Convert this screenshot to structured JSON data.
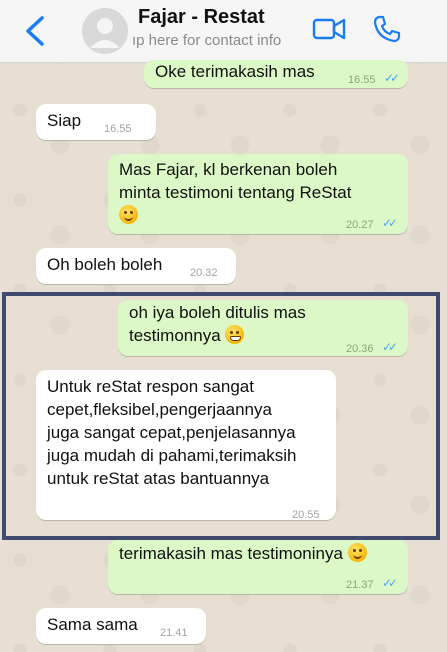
{
  "header": {
    "contact_name": "Fajar - Restat",
    "subtitle": "ıp here for contact info"
  },
  "messages": [
    {
      "dir": "out",
      "text": "Oke terimakasih mas",
      "time": "16.55"
    },
    {
      "dir": "in",
      "text": "Siap",
      "time": "16.55"
    },
    {
      "dir": "out",
      "lines": [
        "Mas Fajar, kl berkenan boleh",
        "minta testimoni tentang ReStat"
      ],
      "emoji": "smile",
      "time": "20.27"
    },
    {
      "dir": "in",
      "text": "Oh boleh boleh",
      "time": "20.32"
    },
    {
      "dir": "out",
      "lines": [
        "oh iya boleh ditulis mas",
        "testimonnya"
      ],
      "emoji": "grin",
      "time": "20.36"
    },
    {
      "dir": "in",
      "lines": [
        "Untuk reStat respon sangat",
        "cepet,fleksibel,pengerjaannya",
        "juga sangat cepat,penjelasannya",
        "juga mudah di pahami,terimaksih",
        "untuk reStat atas bantuannya"
      ],
      "time": "20.55"
    },
    {
      "dir": "out",
      "text": "terimakasih mas testimoninya",
      "emoji": "smile",
      "time": "21.37"
    },
    {
      "dir": "in",
      "text": "Sama sama",
      "time": "21.41"
    }
  ],
  "colors": {
    "incoming": "#ffffff",
    "outgoing": "#dcf8c6",
    "accent": "#1a7cf5",
    "highlight_frame": "#3f4a6e"
  },
  "icons": [
    "back-chevron-icon",
    "avatar-placeholder-icon",
    "video-call-icon",
    "phone-call-icon",
    "double-check-icon",
    "smile-emoji-icon",
    "grin-emoji-icon"
  ]
}
